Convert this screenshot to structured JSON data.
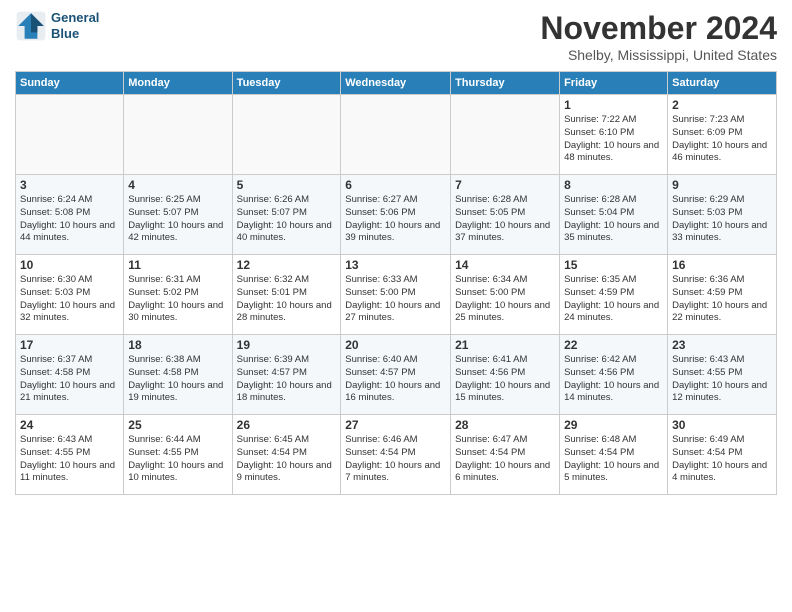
{
  "header": {
    "logo_line1": "General",
    "logo_line2": "Blue",
    "month": "November 2024",
    "location": "Shelby, Mississippi, United States"
  },
  "weekdays": [
    "Sunday",
    "Monday",
    "Tuesday",
    "Wednesday",
    "Thursday",
    "Friday",
    "Saturday"
  ],
  "weeks": [
    [
      {
        "day": "",
        "empty": true
      },
      {
        "day": "",
        "empty": true
      },
      {
        "day": "",
        "empty": true
      },
      {
        "day": "",
        "empty": true
      },
      {
        "day": "",
        "empty": true
      },
      {
        "day": "1",
        "sunrise": "Sunrise: 7:22 AM",
        "sunset": "Sunset: 6:10 PM",
        "daylight": "Daylight: 10 hours and 48 minutes."
      },
      {
        "day": "2",
        "sunrise": "Sunrise: 7:23 AM",
        "sunset": "Sunset: 6:09 PM",
        "daylight": "Daylight: 10 hours and 46 minutes."
      }
    ],
    [
      {
        "day": "3",
        "sunrise": "Sunrise: 6:24 AM",
        "sunset": "Sunset: 5:08 PM",
        "daylight": "Daylight: 10 hours and 44 minutes."
      },
      {
        "day": "4",
        "sunrise": "Sunrise: 6:25 AM",
        "sunset": "Sunset: 5:07 PM",
        "daylight": "Daylight: 10 hours and 42 minutes."
      },
      {
        "day": "5",
        "sunrise": "Sunrise: 6:26 AM",
        "sunset": "Sunset: 5:07 PM",
        "daylight": "Daylight: 10 hours and 40 minutes."
      },
      {
        "day": "6",
        "sunrise": "Sunrise: 6:27 AM",
        "sunset": "Sunset: 5:06 PM",
        "daylight": "Daylight: 10 hours and 39 minutes."
      },
      {
        "day": "7",
        "sunrise": "Sunrise: 6:28 AM",
        "sunset": "Sunset: 5:05 PM",
        "daylight": "Daylight: 10 hours and 37 minutes."
      },
      {
        "day": "8",
        "sunrise": "Sunrise: 6:28 AM",
        "sunset": "Sunset: 5:04 PM",
        "daylight": "Daylight: 10 hours and 35 minutes."
      },
      {
        "day": "9",
        "sunrise": "Sunrise: 6:29 AM",
        "sunset": "Sunset: 5:03 PM",
        "daylight": "Daylight: 10 hours and 33 minutes."
      }
    ],
    [
      {
        "day": "10",
        "sunrise": "Sunrise: 6:30 AM",
        "sunset": "Sunset: 5:03 PM",
        "daylight": "Daylight: 10 hours and 32 minutes."
      },
      {
        "day": "11",
        "sunrise": "Sunrise: 6:31 AM",
        "sunset": "Sunset: 5:02 PM",
        "daylight": "Daylight: 10 hours and 30 minutes."
      },
      {
        "day": "12",
        "sunrise": "Sunrise: 6:32 AM",
        "sunset": "Sunset: 5:01 PM",
        "daylight": "Daylight: 10 hours and 28 minutes."
      },
      {
        "day": "13",
        "sunrise": "Sunrise: 6:33 AM",
        "sunset": "Sunset: 5:00 PM",
        "daylight": "Daylight: 10 hours and 27 minutes."
      },
      {
        "day": "14",
        "sunrise": "Sunrise: 6:34 AM",
        "sunset": "Sunset: 5:00 PM",
        "daylight": "Daylight: 10 hours and 25 minutes."
      },
      {
        "day": "15",
        "sunrise": "Sunrise: 6:35 AM",
        "sunset": "Sunset: 4:59 PM",
        "daylight": "Daylight: 10 hours and 24 minutes."
      },
      {
        "day": "16",
        "sunrise": "Sunrise: 6:36 AM",
        "sunset": "Sunset: 4:59 PM",
        "daylight": "Daylight: 10 hours and 22 minutes."
      }
    ],
    [
      {
        "day": "17",
        "sunrise": "Sunrise: 6:37 AM",
        "sunset": "Sunset: 4:58 PM",
        "daylight": "Daylight: 10 hours and 21 minutes."
      },
      {
        "day": "18",
        "sunrise": "Sunrise: 6:38 AM",
        "sunset": "Sunset: 4:58 PM",
        "daylight": "Daylight: 10 hours and 19 minutes."
      },
      {
        "day": "19",
        "sunrise": "Sunrise: 6:39 AM",
        "sunset": "Sunset: 4:57 PM",
        "daylight": "Daylight: 10 hours and 18 minutes."
      },
      {
        "day": "20",
        "sunrise": "Sunrise: 6:40 AM",
        "sunset": "Sunset: 4:57 PM",
        "daylight": "Daylight: 10 hours and 16 minutes."
      },
      {
        "day": "21",
        "sunrise": "Sunrise: 6:41 AM",
        "sunset": "Sunset: 4:56 PM",
        "daylight": "Daylight: 10 hours and 15 minutes."
      },
      {
        "day": "22",
        "sunrise": "Sunrise: 6:42 AM",
        "sunset": "Sunset: 4:56 PM",
        "daylight": "Daylight: 10 hours and 14 minutes."
      },
      {
        "day": "23",
        "sunrise": "Sunrise: 6:43 AM",
        "sunset": "Sunset: 4:55 PM",
        "daylight": "Daylight: 10 hours and 12 minutes."
      }
    ],
    [
      {
        "day": "24",
        "sunrise": "Sunrise: 6:43 AM",
        "sunset": "Sunset: 4:55 PM",
        "daylight": "Daylight: 10 hours and 11 minutes."
      },
      {
        "day": "25",
        "sunrise": "Sunrise: 6:44 AM",
        "sunset": "Sunset: 4:55 PM",
        "daylight": "Daylight: 10 hours and 10 minutes."
      },
      {
        "day": "26",
        "sunrise": "Sunrise: 6:45 AM",
        "sunset": "Sunset: 4:54 PM",
        "daylight": "Daylight: 10 hours and 9 minutes."
      },
      {
        "day": "27",
        "sunrise": "Sunrise: 6:46 AM",
        "sunset": "Sunset: 4:54 PM",
        "daylight": "Daylight: 10 hours and 7 minutes."
      },
      {
        "day": "28",
        "sunrise": "Sunrise: 6:47 AM",
        "sunset": "Sunset: 4:54 PM",
        "daylight": "Daylight: 10 hours and 6 minutes."
      },
      {
        "day": "29",
        "sunrise": "Sunrise: 6:48 AM",
        "sunset": "Sunset: 4:54 PM",
        "daylight": "Daylight: 10 hours and 5 minutes."
      },
      {
        "day": "30",
        "sunrise": "Sunrise: 6:49 AM",
        "sunset": "Sunset: 4:54 PM",
        "daylight": "Daylight: 10 hours and 4 minutes."
      }
    ]
  ]
}
